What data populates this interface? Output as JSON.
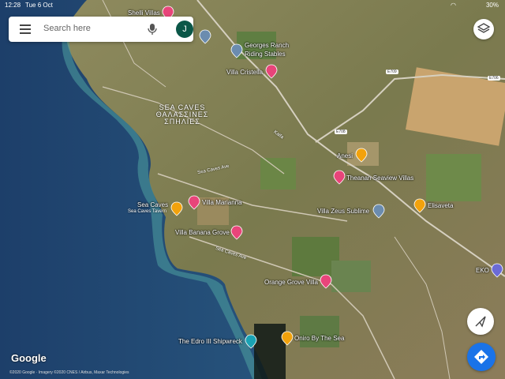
{
  "status_bar": {
    "time": "12:28",
    "date": "Tue 6 Oct",
    "battery": "30%"
  },
  "search": {
    "placeholder": "Search here",
    "avatar_initial": "J"
  },
  "map_labels": {
    "shelli_villas": "Shelli Villas",
    "georges_ranch_1": "Georges Ranch",
    "georges_ranch_2": "Riding Stables",
    "villa_cristella": "Villa Cristella",
    "sea_caves_area_1": "SEA CAVES",
    "sea_caves_area_2": "ΘΑΛΑΣΣΙΝΕΣ",
    "sea_caves_area_3": "ΣΠΗΛΙΕΣ",
    "anesi": "Anesi",
    "theanan": "Theanan Seaview Villas",
    "sea_caves": "Sea Caves",
    "sea_caves_tavern": "Sea Caves Tavern",
    "villa_marianna": "Villa Marianna",
    "villa_zeus": "Villa Zeus Sublime",
    "elisaveta": "Elisaveta",
    "villa_banana": "Villa Banana Grove",
    "orange_grove": "Orange Grove Villa",
    "eko": "EKO",
    "edro": "The Edro III Shipwreck",
    "oniro": "Oniro By The Sea"
  },
  "roads": {
    "e709": "E709",
    "e708": "E708",
    "e706": "E706",
    "kaifa": "Kaifa",
    "sea_caves_ave_1": "Sea Caves Ave",
    "sea_caves_ave_2": "Sea Caves Ave"
  },
  "branding": {
    "logo": "Google",
    "copyright": "©2020 Google · Imagery ©2020 CNES / Airbus, Maxar Technologies"
  },
  "colors": {
    "sea_deep": "#1f4f7a",
    "sea_shallow": "#3f8f9a",
    "land": "#8a8a5a",
    "pin_pink": "#e8457a",
    "pin_orange": "#f2a20c",
    "pin_gray": "#6b8caf",
    "pin_teal": "#1aa3b4",
    "accent": "#1a73e8"
  }
}
